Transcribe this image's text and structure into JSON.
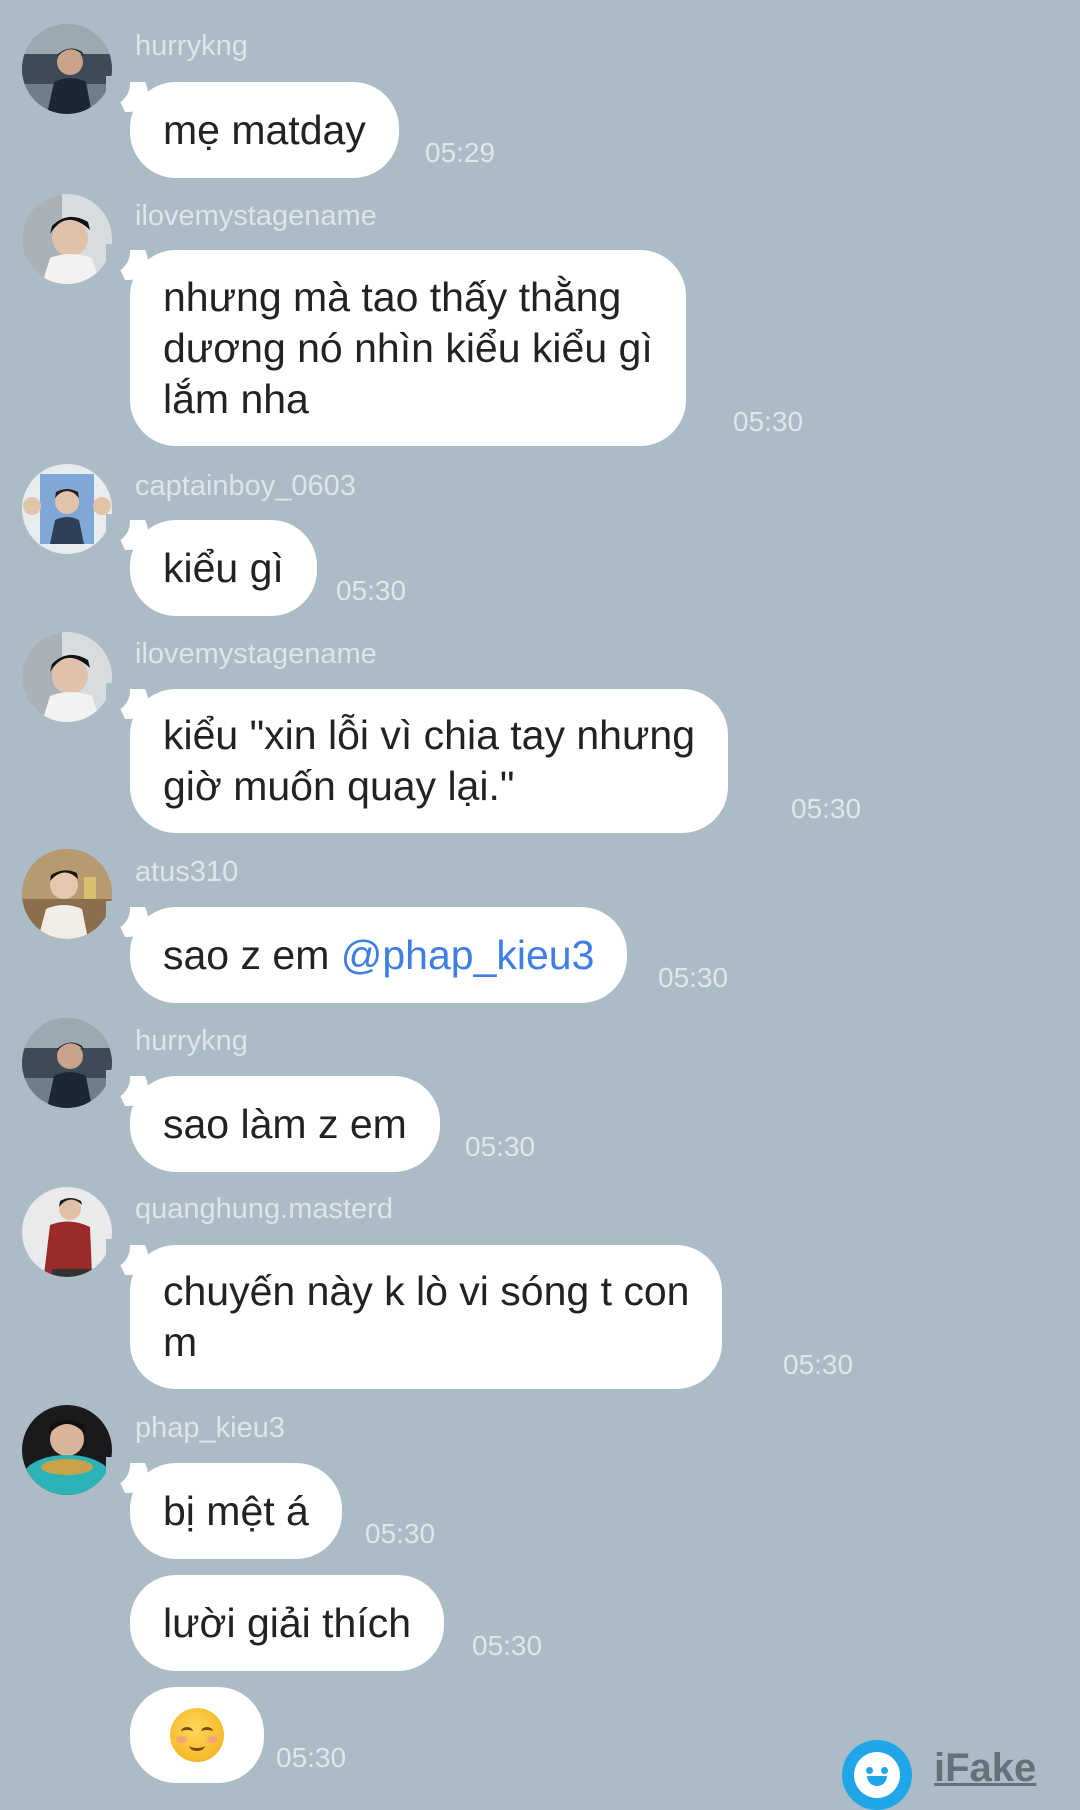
{
  "messages": [
    {
      "sender": "hurrykng",
      "lines": [
        "mẹ matday"
      ],
      "time": "05:29",
      "avatar": "avatar-hurrykng"
    },
    {
      "sender": "ilovemystagename",
      "lines": [
        "nhưng mà tao thấy thằng",
        "dương nó nhìn kiểu kiểu gì",
        "lắm nha"
      ],
      "time": "05:30",
      "avatar": "avatar-ilovemystagename"
    },
    {
      "sender": "captainboy_0603",
      "lines": [
        "kiểu gì"
      ],
      "time": "05:30",
      "avatar": "avatar-captainboy"
    },
    {
      "sender": "ilovemystagename",
      "lines": [
        "kiểu \"xin lỗi vì chia tay nhưng",
        "giờ muốn quay lại.\""
      ],
      "time": "05:30",
      "avatar": "avatar-ilovemystagename"
    },
    {
      "sender": "atus310",
      "text_before_mention": "sao z em ",
      "mention": "@phap_kieu3",
      "time": "05:30",
      "avatar": "avatar-atus310"
    },
    {
      "sender": "hurrykng",
      "lines": [
        "sao làm z em"
      ],
      "time": "05:30",
      "avatar": "avatar-hurrykng"
    },
    {
      "sender": "quanghung.masterd",
      "lines": [
        "chuyến này k lò vi sóng t con",
        "m"
      ],
      "time": "05:30",
      "avatar": "avatar-quanghung"
    },
    {
      "sender": "phap_kieu3",
      "lines": [
        "bị mệt á"
      ],
      "time": "05:30",
      "avatar": "avatar-phapkieu"
    },
    {
      "lines": [
        "lười giải thích"
      ],
      "time": "05:30"
    },
    {
      "emoji": "smiling-face-with-blush-emoji",
      "time": "05:30"
    }
  ],
  "watermark": {
    "label": "iFake",
    "icon": "ifake-smile-icon"
  },
  "colors": {
    "background": "#acbcc7",
    "bubble": "#ffffff",
    "mention": "#3f7ee2",
    "meta_text": "#dde5ea"
  }
}
